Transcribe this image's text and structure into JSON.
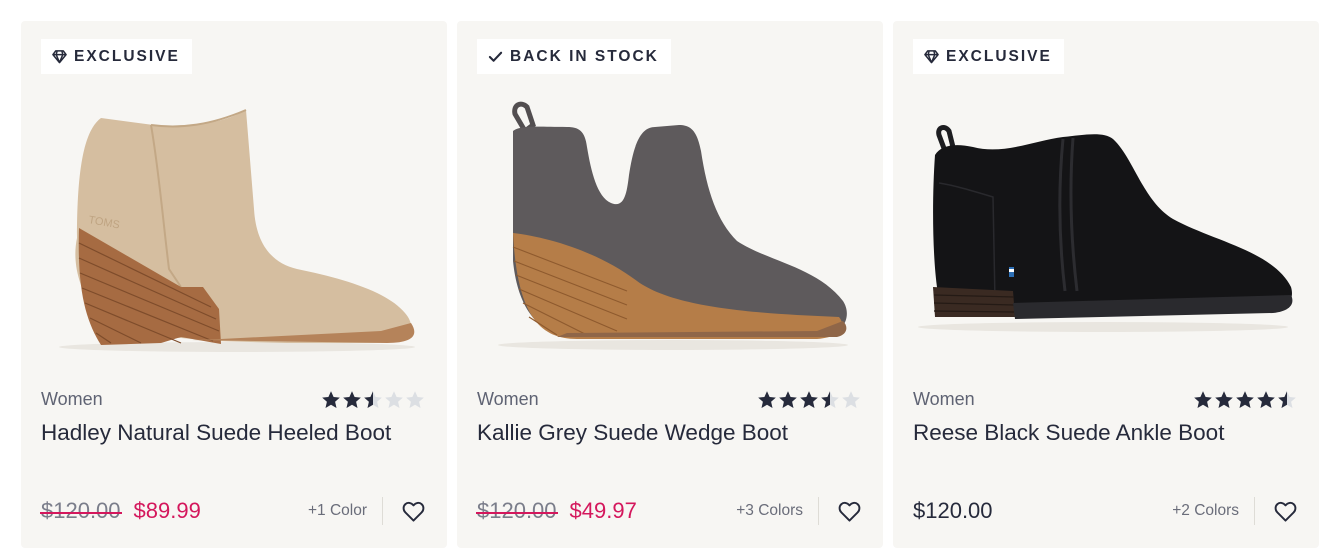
{
  "colors": {
    "text": "#262a3b",
    "muted": "#5f6373",
    "sale": "#d4175c",
    "star_filled": "#262a3b",
    "star_empty": "#dcdfe3",
    "card_bg": "#f7f6f3"
  },
  "products": [
    {
      "badge": {
        "icon": "diamond-icon",
        "label": "EXCLUSIVE"
      },
      "image": {
        "kind": "heeled-bootie",
        "upper": "#d5bea0",
        "heel": "#a66b42"
      },
      "category": "Women",
      "rating": 2.5,
      "name": "Hadley Natural Suede Heeled Boot",
      "original_price": "$120.00",
      "sale_price": "$89.99",
      "price": null,
      "colors_label": "+1 Color"
    },
    {
      "badge": {
        "icon": "checkmark-icon",
        "label": "BACK IN STOCK"
      },
      "image": {
        "kind": "wedge-bootie",
        "upper": "#5e5a5c",
        "heel": "#b57d48"
      },
      "category": "Women",
      "rating": 3.5,
      "name": "Kallie Grey Suede Wedge Boot",
      "original_price": "$120.00",
      "sale_price": "$49.97",
      "price": null,
      "colors_label": "+3 Colors"
    },
    {
      "badge": {
        "icon": "diamond-icon",
        "label": "EXCLUSIVE"
      },
      "image": {
        "kind": "ankle-boot",
        "upper": "#141416",
        "heel": "#3a2a22"
      },
      "category": "Women",
      "rating": 4.5,
      "name": "Reese Black Suede Ankle Boot",
      "original_price": null,
      "sale_price": null,
      "price": "$120.00",
      "colors_label": "+2 Colors"
    }
  ]
}
